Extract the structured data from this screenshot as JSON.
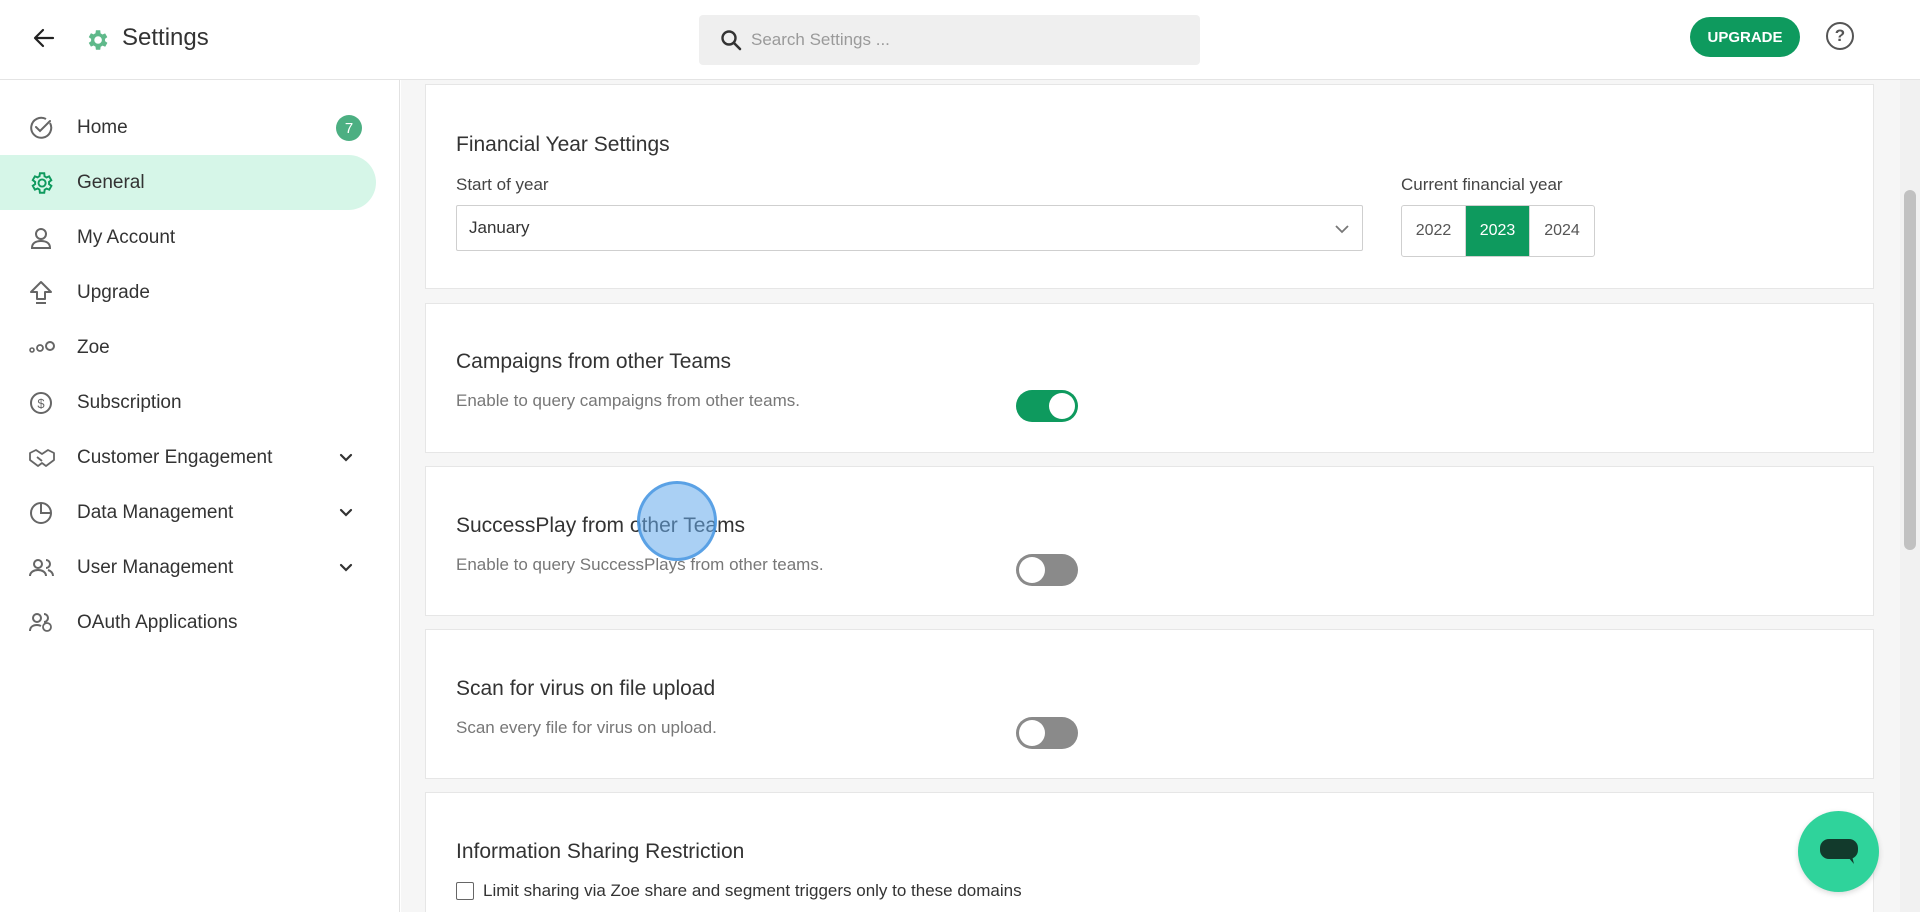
{
  "header": {
    "title": "Settings",
    "search_placeholder": "Search Settings ...",
    "upgrade_label": "UPGRADE",
    "help_label": "?"
  },
  "sidebar": {
    "items": [
      {
        "label": "Home",
        "icon": "check-circle-icon",
        "badge": "7"
      },
      {
        "label": "General",
        "icon": "gear-icon",
        "active": true
      },
      {
        "label": "My Account",
        "icon": "person-icon"
      },
      {
        "label": "Upgrade",
        "icon": "upgrade-arrow-icon"
      },
      {
        "label": "Zoe",
        "icon": "zoe-dots-icon"
      },
      {
        "label": "Subscription",
        "icon": "dollar-circle-icon"
      },
      {
        "label": "Customer Engagement",
        "icon": "handshake-icon",
        "expandable": true
      },
      {
        "label": "Data Management",
        "icon": "pie-chart-icon",
        "expandable": true
      },
      {
        "label": "User Management",
        "icon": "users-icon",
        "expandable": true
      },
      {
        "label": "OAuth Applications",
        "icon": "oauth-users-icon"
      }
    ]
  },
  "financial_year": {
    "title": "Financial Year Settings",
    "start_label": "Start of year",
    "start_value": "January",
    "current_label": "Current financial year",
    "years": [
      "2022",
      "2023",
      "2024"
    ],
    "selected_year": "2023"
  },
  "campaigns": {
    "title": "Campaigns from other Teams",
    "desc": "Enable to query campaigns from other teams.",
    "enabled": true
  },
  "successplay": {
    "title": "SuccessPlay from other Teams",
    "desc": "Enable to query SuccessPlays from other teams.",
    "enabled": false
  },
  "virus_scan": {
    "title": "Scan for virus on file upload",
    "desc": "Scan every file for virus on upload.",
    "enabled": false
  },
  "info_sharing": {
    "title": "Information Sharing Restriction",
    "checkbox_label": "Limit sharing via Zoe share and segment triggers only to these domains",
    "checked": false
  },
  "colors": {
    "accent": "#0e9a5e",
    "active_nav_bg": "#d6f6e8",
    "chat_fab": "#2fd39b"
  }
}
